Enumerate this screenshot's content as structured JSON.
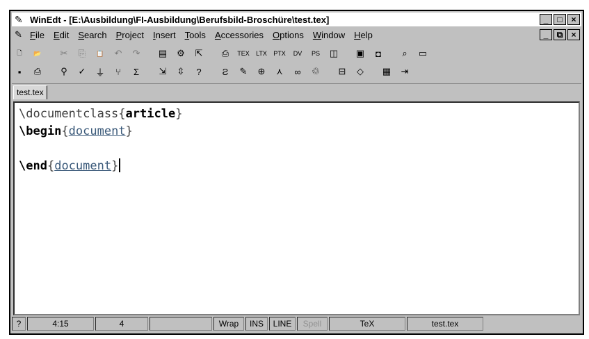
{
  "window": {
    "title": "WinEdt - [E:\\Ausbildung\\FI-Ausbildung\\Berufsbild-Broschüre\\test.tex]",
    "controls": [
      "_",
      "□",
      "×"
    ],
    "mdi_controls": [
      "_",
      "⧉",
      "×"
    ]
  },
  "menu": [
    {
      "label": "File",
      "accel": "F",
      "rest": "ile"
    },
    {
      "label": "Edit",
      "accel": "E",
      "rest": "dit"
    },
    {
      "label": "Search",
      "accel": "S",
      "rest": "earch"
    },
    {
      "label": "Project",
      "accel": "P",
      "rest": "roject"
    },
    {
      "label": "Insert",
      "accel": "I",
      "rest": "nsert"
    },
    {
      "label": "Tools",
      "accel": "T",
      "rest": "ools"
    },
    {
      "label": "Accessories",
      "accel": "A",
      "rest": "ccessories"
    },
    {
      "label": "Options",
      "accel": "O",
      "rest": "ptions"
    },
    {
      "label": "Window",
      "accel": "W",
      "rest": "indow"
    },
    {
      "label": "Help",
      "accel": "H",
      "rest": "elp"
    }
  ],
  "toolbar1": [
    {
      "icon": "new-file-icon",
      "glyph": "🗋"
    },
    {
      "icon": "open-file-icon",
      "glyph": "📂"
    },
    {
      "sep": true
    },
    {
      "icon": "cut-icon",
      "glyph": "✂",
      "grey": true
    },
    {
      "icon": "copy-icon",
      "glyph": "⎘",
      "grey": true
    },
    {
      "icon": "paste-icon",
      "glyph": "📋",
      "grey": true
    },
    {
      "icon": "undo-icon",
      "glyph": "↶",
      "grey": true
    },
    {
      "icon": "redo-icon",
      "glyph": "↷",
      "grey": true
    },
    {
      "sep": true
    },
    {
      "icon": "document-icon",
      "glyph": "▤"
    },
    {
      "icon": "gear-icon",
      "glyph": "⚙"
    },
    {
      "icon": "export-icon",
      "glyph": "⇱"
    },
    {
      "sep": true
    },
    {
      "icon": "compile-icon",
      "glyph": "⎙"
    },
    {
      "icon": "tex-icon",
      "glyph": "TEX"
    },
    {
      "icon": "latex-icon",
      "glyph": "LTX"
    },
    {
      "icon": "pdftex-icon",
      "glyph": "PTX"
    },
    {
      "icon": "dvi-icon",
      "glyph": "DV"
    },
    {
      "icon": "dvips-icon",
      "glyph": "PS"
    },
    {
      "icon": "view-icon",
      "glyph": "◫"
    },
    {
      "sep": true
    },
    {
      "icon": "bibtex-icon",
      "glyph": "▣"
    },
    {
      "icon": "camera-icon",
      "glyph": "◘"
    },
    {
      "sep": true
    },
    {
      "icon": "zoom-icon",
      "glyph": "⌕"
    },
    {
      "icon": "monitor-icon",
      "glyph": "▭"
    }
  ],
  "toolbar2": [
    {
      "icon": "save-icon",
      "glyph": "▪"
    },
    {
      "icon": "print-icon",
      "glyph": "⎙"
    },
    {
      "sep": true
    },
    {
      "icon": "find-icon",
      "glyph": "⚲"
    },
    {
      "icon": "spell-icon",
      "glyph": "✓"
    },
    {
      "icon": "filter-icon",
      "glyph": "⏚"
    },
    {
      "icon": "tree-icon",
      "glyph": "⑂"
    },
    {
      "icon": "sigma-icon",
      "glyph": "Σ"
    },
    {
      "sep": true
    },
    {
      "icon": "open-project-icon",
      "glyph": "⇲"
    },
    {
      "icon": "close-project-icon",
      "glyph": "⇳"
    },
    {
      "icon": "help-icon",
      "glyph": "?"
    },
    {
      "sep": true
    },
    {
      "icon": "search-replace-icon",
      "glyph": "Ƨ"
    },
    {
      "icon": "macro-icon",
      "glyph": "✎"
    },
    {
      "icon": "magnify-icon",
      "glyph": "⊕"
    },
    {
      "icon": "compass-icon",
      "glyph": "⋏"
    },
    {
      "icon": "binoculars-icon",
      "glyph": "∞"
    },
    {
      "icon": "trash-icon",
      "glyph": "♲"
    },
    {
      "sep": true
    },
    {
      "icon": "bookmark-icon",
      "glyph": "⊟"
    },
    {
      "icon": "eraser-icon",
      "glyph": "◇"
    },
    {
      "sep": true
    },
    {
      "icon": "table-icon",
      "glyph": "▦"
    },
    {
      "icon": "exit-icon",
      "glyph": "⇥"
    }
  ],
  "tabs": [
    {
      "label": "test.tex"
    }
  ],
  "editor": {
    "lines": [
      [
        {
          "t": "\\documentclass",
          "c": "cmd"
        },
        {
          "t": "{",
          "c": "brace"
        },
        {
          "t": "article",
          "c": "arg"
        },
        {
          "t": "}",
          "c": "brace"
        }
      ],
      [
        {
          "t": "\\begin",
          "c": "kw"
        },
        {
          "t": "{",
          "c": "brace"
        },
        {
          "t": "document",
          "c": "env"
        },
        {
          "t": "}",
          "c": "brace"
        }
      ],
      [],
      [
        {
          "t": "\\end",
          "c": "kw"
        },
        {
          "t": "{",
          "c": "brace"
        },
        {
          "t": "document",
          "c": "env"
        },
        {
          "t": "}",
          "c": "brace"
        },
        {
          "cursor": true
        }
      ]
    ]
  },
  "statusbar": [
    {
      "name": "status-help",
      "text": "?",
      "w": 20
    },
    {
      "name": "status-position",
      "text": "4:15",
      "w": 96
    },
    {
      "name": "status-lines",
      "text": "4",
      "w": 76
    },
    {
      "name": "status-blank",
      "text": "",
      "w": 90
    },
    {
      "name": "status-wrap",
      "text": "Wrap",
      "w": 44
    },
    {
      "name": "status-ins",
      "text": "INS",
      "w": 32
    },
    {
      "name": "status-line-mode",
      "text": "LINE",
      "w": 38
    },
    {
      "name": "status-spell",
      "text": "Spell",
      "w": 44,
      "dim": true
    },
    {
      "name": "status-mode",
      "text": "TeX",
      "w": 110
    },
    {
      "name": "status-file",
      "text": "test.tex",
      "w": 110
    }
  ]
}
